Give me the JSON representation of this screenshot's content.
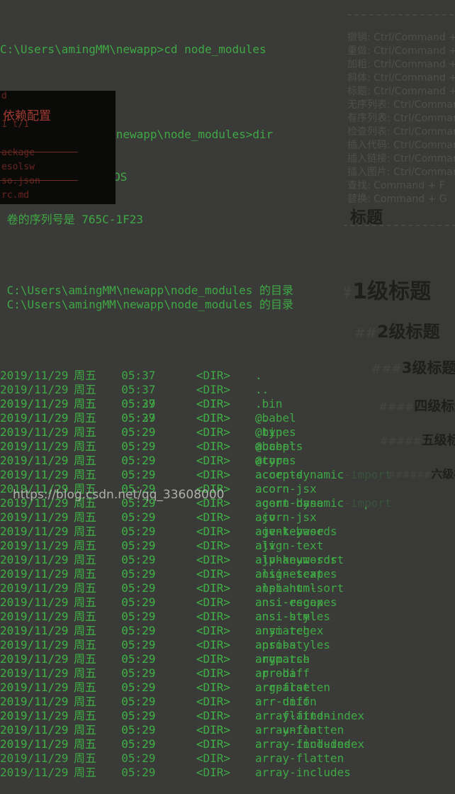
{
  "terminal": {
    "prompt_lines": [
      "C:\\Users\\amingMM\\newapp>cd node_modules",
      "",
      "C:\\Users\\amingMM\\newapp\\node_modules>dir",
      " 驱动器 C 中的卷是 OS",
      " 卷的序列号是 765C-1F23",
      "",
      " C:\\Users\\amingMM\\newapp\\node_modules 的目录",
      ""
    ],
    "cmd1": "C:\\Users\\amingMM\\newapp>cd node_modules",
    "cmd2": "C:\\Users\\amingMM\\newapp\\node_modules>dir",
    "volume_line": " 驱动器 C 中的卷是 OS",
    "serial_line": " 卷的序列号是 765C-1F23",
    "dir_header": " C:\\Users\\amingMM\\newapp\\node_modules 的目录",
    "dir_marker": "<DIR>",
    "weekday": "周五",
    "entries": [
      {
        "date": "2019/11/29",
        "week": "周五",
        "time": "05:37",
        "type": "<DIR>",
        "name": "."
      },
      {
        "date": "2019/11/29",
        "week": "周五",
        "time": "05:37",
        "type": "<DIR>",
        "name": ".."
      },
      {
        "date": "2019/11/29",
        "week": "周五",
        "time": "05:29",
        "type": "<DIR>",
        "name": ".bin"
      },
      {
        "date": "2019/11/29",
        "week": "周五",
        "time": "05:29",
        "type": "<DIR>",
        "name": "@babel"
      },
      {
        "date": "2019/11/29",
        "week": "周五",
        "time": "05:29",
        "type": "<DIR>",
        "name": "@types"
      },
      {
        "date": "2019/11/29",
        "week": "周五",
        "time": "05:29",
        "type": "<DIR>",
        "name": "accepts"
      },
      {
        "date": "2019/11/29",
        "week": "周五",
        "time": "05:29",
        "type": "<DIR>",
        "name": "acorn"
      },
      {
        "date": "2019/11/29",
        "week": "周五",
        "time": "05:29",
        "type": "<DIR>",
        "name": "acorn-dynamic-import"
      },
      {
        "date": "2019/11/29",
        "week": "周五",
        "time": "05:29",
        "type": "<DIR>",
        "name": "acorn-jsx"
      },
      {
        "date": "2019/11/29",
        "week": "周五",
        "time": "05:29",
        "type": "<DIR>",
        "name": "agent-base"
      },
      {
        "date": "2019/11/29",
        "week": "周五",
        "time": "05:29",
        "type": "<DIR>",
        "name": "ajv"
      },
      {
        "date": "2019/11/29",
        "week": "周五",
        "time": "05:29",
        "type": "<DIR>",
        "name": "ajv-keywords"
      },
      {
        "date": "2019/11/29",
        "week": "周五",
        "time": "05:29",
        "type": "<DIR>",
        "name": "align-text"
      },
      {
        "date": "2019/11/29",
        "week": "周五",
        "time": "05:29",
        "type": "<DIR>",
        "name": "alphanum-sort"
      },
      {
        "date": "2019/11/29",
        "week": "周五",
        "time": "05:29",
        "type": "<DIR>",
        "name": "ansi-escapes"
      },
      {
        "date": "2019/11/29",
        "week": "周五",
        "time": "05:29",
        "type": "<DIR>",
        "name": "ansi-html"
      },
      {
        "date": "2019/11/29",
        "week": "周五",
        "time": "05:29",
        "type": "<DIR>",
        "name": "ansi-regex"
      },
      {
        "date": "2019/11/29",
        "week": "周五",
        "time": "05:29",
        "type": "<DIR>",
        "name": "ansi-styles"
      },
      {
        "date": "2019/11/29",
        "week": "周五",
        "time": "05:29",
        "type": "<DIR>",
        "name": "anymatch"
      },
      {
        "date": "2019/11/29",
        "week": "周五",
        "time": "05:29",
        "type": "<DIR>",
        "name": "aproba"
      },
      {
        "date": "2019/11/29",
        "week": "周五",
        "time": "05:29",
        "type": "<DIR>",
        "name": "argparse"
      },
      {
        "date": "2019/11/29",
        "week": "周五",
        "time": "05:29",
        "type": "<DIR>",
        "name": "arr-diff"
      },
      {
        "date": "2019/11/29",
        "week": "周五",
        "time": "05:29",
        "type": "<DIR>",
        "name": "arr-flatten"
      },
      {
        "date": "2019/11/29",
        "week": "周五",
        "time": "05:29",
        "type": "<DIR>",
        "name": "arr-union"
      },
      {
        "date": "2019/11/29",
        "week": "周五",
        "time": "05:29",
        "type": "<DIR>",
        "name": "array-find-index"
      },
      {
        "date": "2019/11/29",
        "week": "周五",
        "time": "05:29",
        "type": "<DIR>",
        "name": "array-flatten"
      },
      {
        "date": "2019/11/29",
        "week": "周五",
        "time": "05:29",
        "type": "<DIR>",
        "name": "array-includes"
      }
    ]
  },
  "ghost_overlay": {
    "red_title": "依赖配置",
    "faint_lines": [
      "d",
      "",
      "1 t/1",
      "",
      "ackage",
      "esolsw",
      "so.json",
      "rc.md"
    ]
  },
  "md_panel": {
    "shortcuts": [
      {
        "label": "撤销:",
        "keys": "Ctrl/Command + Z"
      },
      {
        "label": "重做:",
        "keys": "Ctrl/Command + Y"
      },
      {
        "label": "加粗:",
        "keys": "Ctrl/Command + B"
      },
      {
        "label": "斜体:",
        "keys": "Ctrl/Command + I"
      },
      {
        "label": "标题:",
        "keys": "Ctrl/Command + Shift + H"
      },
      {
        "label": "无序列表:",
        "keys": "Ctrl/Command + Shift + U"
      },
      {
        "label": "有序列表:",
        "keys": "Ctrl/Command + Shift + O"
      },
      {
        "label": "检查列表:",
        "keys": "Ctrl/Command + Shift + C"
      },
      {
        "label": "插入代码:",
        "keys": "Ctrl/Command + Shift + K"
      },
      {
        "label": "插入链接:",
        "keys": "Ctrl/Command + Shift + L"
      },
      {
        "label": "插入图片:",
        "keys": "Ctrl/Command + Shift + G"
      },
      {
        "label": "查找:",
        "keys": "Command + F"
      },
      {
        "label": "替换:",
        "keys": "Command + G"
      }
    ],
    "section_title": "标题",
    "headings": [
      {
        "hashes": "#",
        "text": "1级标题"
      },
      {
        "hashes": "##",
        "text": "2级标题"
      },
      {
        "hashes": "###",
        "text": "3级标题"
      },
      {
        "hashes": "####",
        "text": "四级标题"
      },
      {
        "hashes": "#####",
        "text": "五级标题"
      },
      {
        "hashes": "######",
        "text": "六级标题"
      }
    ]
  },
  "watermark": {
    "url": "https://blog.csdn.net/qq_33608000"
  },
  "colors": {
    "terminal_bg": "#3a3a38",
    "terminal_green": "#3fa845",
    "overlay_bg": "#0a0a08",
    "overlay_red": "#a03a33",
    "md_panel_text": "#4e4e4b",
    "md_heading_text": "#1e1e1c"
  }
}
